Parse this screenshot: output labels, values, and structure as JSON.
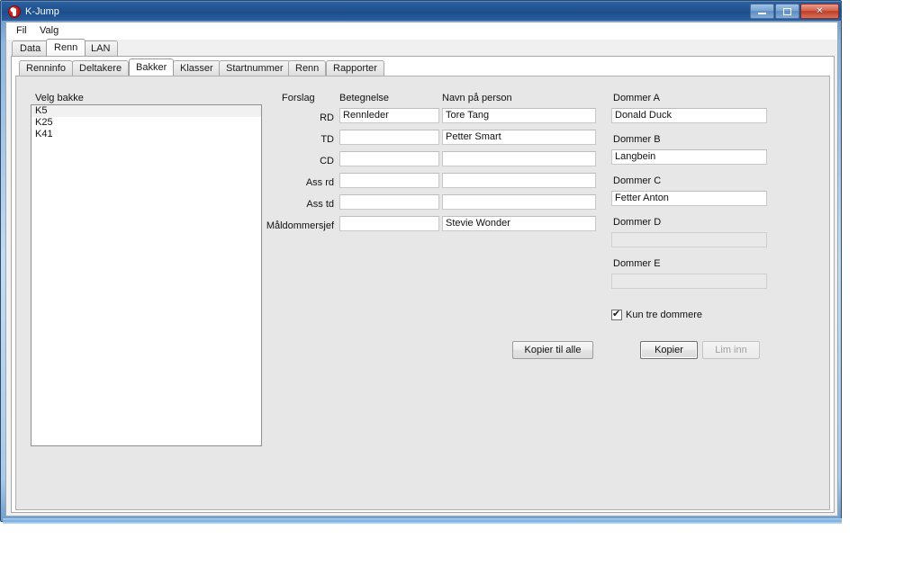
{
  "window": {
    "title": "K-Jump",
    "app_icon": "kjump-icon",
    "controls": {
      "minimize": "minimize-icon",
      "maximize": "maximize-icon",
      "close": "✕"
    }
  },
  "menubar": {
    "items": [
      {
        "label": "Fil"
      },
      {
        "label": "Valg"
      }
    ]
  },
  "outer_tabs": {
    "selected": "Renn",
    "items": [
      {
        "label": "Data"
      },
      {
        "label": "Renn"
      },
      {
        "label": "LAN"
      }
    ]
  },
  "inner_tabs": {
    "selected": "Bakker",
    "items": [
      {
        "label": "Renninfo"
      },
      {
        "label": "Deltakere"
      },
      {
        "label": "Bakker"
      },
      {
        "label": "Klasser"
      },
      {
        "label": "Startnummer"
      },
      {
        "label": "Renn"
      },
      {
        "label": "Rapporter"
      }
    ]
  },
  "hill_picker": {
    "label": "Velg bakke",
    "items": [
      {
        "label": "K5",
        "selected": true
      },
      {
        "label": "K25",
        "selected": false
      },
      {
        "label": "K41",
        "selected": false
      }
    ]
  },
  "officials": {
    "headers": {
      "role": "Forslag",
      "designation": "Betegnelse",
      "person": "Navn på person"
    },
    "rows": [
      {
        "role": "RD",
        "designation": "Rennleder",
        "person": "Tore Tang"
      },
      {
        "role": "TD",
        "designation": "",
        "person": "Petter Smart"
      },
      {
        "role": "CD",
        "designation": "",
        "person": ""
      },
      {
        "role": "Ass rd",
        "designation": "",
        "person": ""
      },
      {
        "role": "Ass td",
        "designation": "",
        "person": ""
      },
      {
        "role": "Måldommersjef",
        "designation": "",
        "person": "Stevie Wonder"
      }
    ]
  },
  "judges": {
    "fields": [
      {
        "label": "Dommer A",
        "value": "Donald Duck",
        "disabled": false
      },
      {
        "label": "Dommer B",
        "value": "Langbein",
        "disabled": false
      },
      {
        "label": "Dommer C",
        "value": "Fetter Anton",
        "disabled": false
      },
      {
        "label": "Dommer D",
        "value": "",
        "disabled": true
      },
      {
        "label": "Dommer E",
        "value": "",
        "disabled": true
      }
    ],
    "checkbox": {
      "label": "Kun tre dommere",
      "checked": true
    }
  },
  "buttons": {
    "copy_to_all": "Kopier til alle",
    "copy": "Kopier",
    "paste": "Lim inn",
    "paste_disabled": true
  },
  "colors": {
    "titlebar": "#1d4d8c",
    "close_button": "#bd3f28",
    "panel_bg": "#e7e7e7",
    "window_frame": "#a9cbe9"
  }
}
